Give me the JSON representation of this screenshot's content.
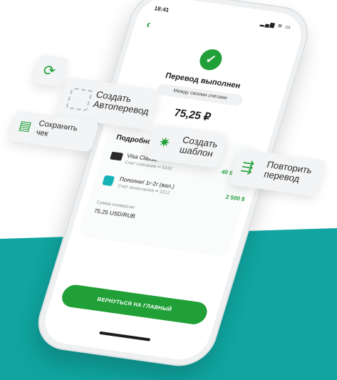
{
  "colors": {
    "accent": "#21a038",
    "teal": "#10a5a0"
  },
  "status_bar": {
    "time": "18:41",
    "signal": "▂▄▆ ≋ ▭"
  },
  "screen": {
    "back_icon": "‹",
    "check_icon": "✓",
    "title": "Перевод выполнен",
    "subtitle_chip": "Между своими счетами",
    "amount": "75,25 ₽",
    "details": {
      "title": "Подробности",
      "from": {
        "name": "Visa Classic",
        "sub": "Счет списания •• 5432",
        "value": "40 558,90 ₽"
      },
      "to": {
        "name": "Пополни! 1г-2г (вал.)",
        "sub": "Счет зачисления •• 3212",
        "value": "2 500 $"
      },
      "conversion_label": "Сумма конверсии",
      "conversion_value": "75,25 USD/RUB"
    },
    "main_button": "ВЕРНУТЬСЯ НА ГЛАВНЫЙ"
  },
  "floating": {
    "refresh_icon": "⟳",
    "autotransfer": "Создать\nАвтоперевод",
    "receipt_icon": "▤",
    "receipt": "Сохранить\nчек",
    "template_icon": "✷",
    "template": "Создать\nшаблон",
    "repeat_icon": "⇶",
    "repeat": "Повторить\nперевод"
  }
}
